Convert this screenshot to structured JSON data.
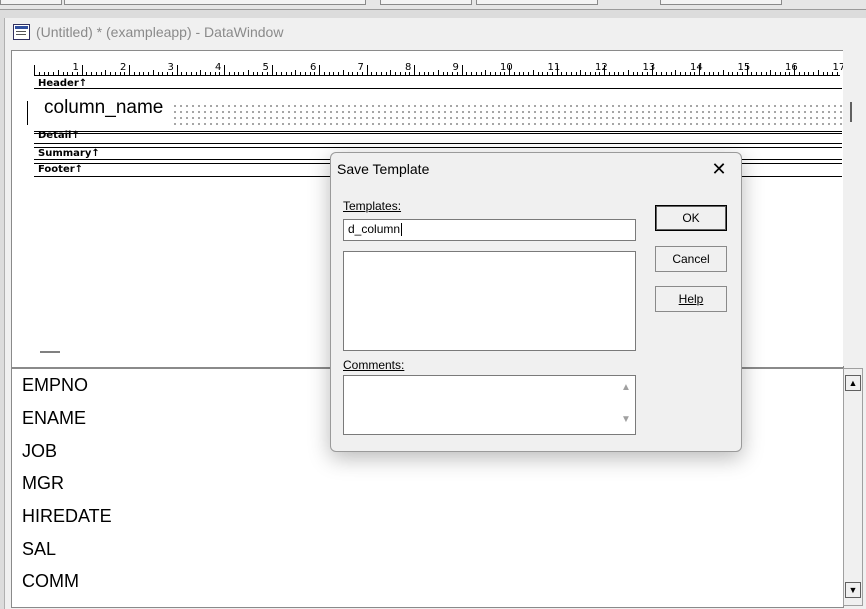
{
  "window": {
    "title": "(Untitled) * (exampleapp) - DataWindow",
    "icon": "datawindow-icon"
  },
  "design": {
    "ruler_numbers": [
      "1",
      "2",
      "3",
      "4",
      "5",
      "6",
      "7",
      "8",
      "9",
      "10",
      "11",
      "12",
      "13",
      "14",
      "15",
      "16",
      "17"
    ],
    "bands": {
      "header": "Header↑",
      "detail": "Detail↑",
      "summary": "Summary↑",
      "footer": "Footer↑"
    },
    "column_label": "column_name"
  },
  "preview": {
    "rows": [
      "EMPNO",
      "ENAME",
      "JOB",
      "MGR",
      "HIREDATE",
      "SAL",
      "COMM"
    ]
  },
  "dialog": {
    "title": "Save Template",
    "close_icon": "close-icon",
    "templates_label": "Templates:",
    "templates_value": "d_column",
    "comments_label": "Comments:",
    "ok_label": "OK",
    "cancel_label": "Cancel",
    "help_label": "Help"
  }
}
